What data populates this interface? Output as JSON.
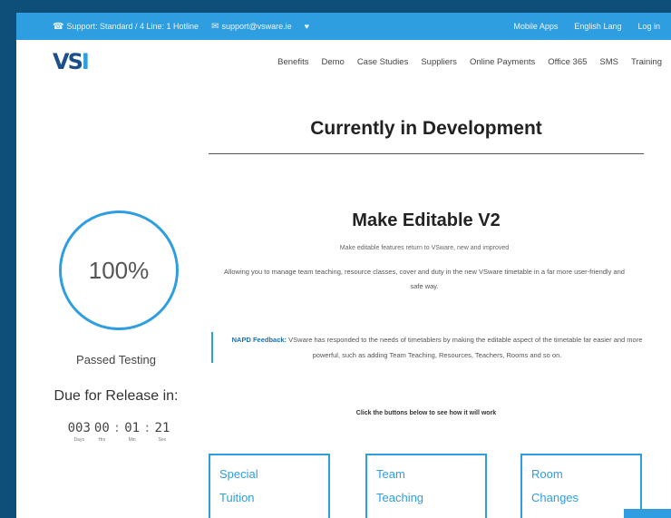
{
  "topbar": {
    "phone": "Support: Standard / 4 Line: 1 Hotline",
    "email": "support@vsware.ie",
    "heart": "♥",
    "links": [
      "Mobile Apps",
      "English Lang",
      "Log in"
    ]
  },
  "nav": {
    "logo_main": "VS",
    "logo_accent": "I",
    "items": [
      "Benefits",
      "Demo",
      "Case Studies",
      "Suppliers",
      "Online Payments",
      "Office 365",
      "SMS",
      "Training"
    ]
  },
  "page": {
    "title": "Currently in Development"
  },
  "status": {
    "percent": "100%",
    "passed": "Passed Testing",
    "due": "Due for Release in:",
    "countdown": [
      {
        "value": "003",
        "label": "Days"
      },
      {
        "value": "00",
        "label": "Hrs"
      },
      {
        "value": "01",
        "label": "Min"
      },
      {
        "value": "21",
        "label": "Sec"
      }
    ],
    "sep_colon": ":"
  },
  "feature": {
    "title": "Make Editable V2",
    "subtitle": "Make editable features return to VSware, new and improved",
    "description": "Allowing you to manage team teaching, resource classes, cover and duty in the new VSware timetable in a far more user-friendly and safe way.",
    "feedback_label": "NAPD Feedback:",
    "feedback_text": " VSware has responded to the needs of timetablers by making the editable aspect of the timetable far easier and more powerful, such as adding Team Teaching, Resources, Teachers, Rooms and so on.",
    "click_note": "Click the buttons below to see how it will work"
  },
  "buttons": [
    {
      "label": "Special Tuition"
    },
    {
      "label": "Team Teaching"
    },
    {
      "label": "Room Changes"
    }
  ]
}
